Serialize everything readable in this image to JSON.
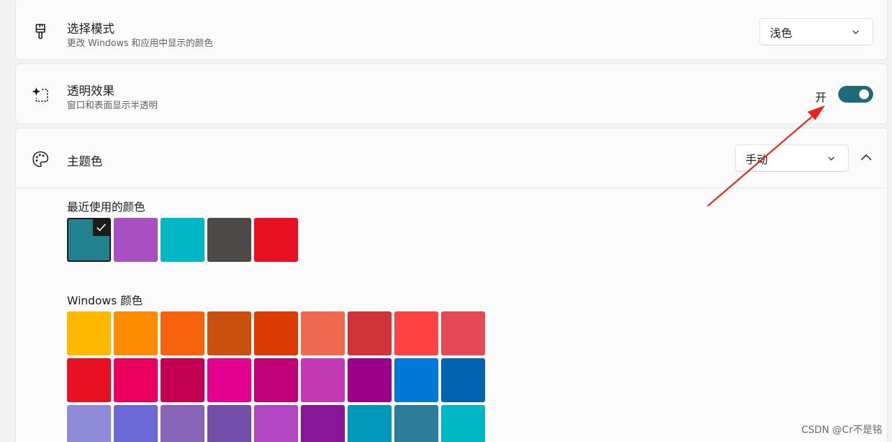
{
  "mode": {
    "title": "选择模式",
    "subtitle": "更改 Windows 和应用中显示的颜色",
    "dropdown_value": "浅色"
  },
  "transparency": {
    "title": "透明效果",
    "subtitle": "窗口和表面显示半透明",
    "toggle_label": "开",
    "toggle_on": true
  },
  "accent": {
    "title": "主题色",
    "dropdown_value": "手动",
    "recent_title": "最近使用的颜色",
    "recent_colors": [
      "#23808f",
      "#a84fc1",
      "#00b7c3",
      "#4c4a48",
      "#e81123"
    ],
    "windows_title": "Windows 颜色",
    "windows_colors": [
      [
        "#ffb900",
        "#ff8c00",
        "#f7630c",
        "#ca5010",
        "#da3b01",
        "#ef6950",
        "#d13438",
        "#ff4343",
        "#e74856"
      ],
      [
        "#e81123",
        "#ea005e",
        "#c30052",
        "#e3008c",
        "#bf0077",
        "#c239b3",
        "#9a0089",
        "#0078d7",
        "#0063b1"
      ],
      [
        "#8e8cd8",
        "#6b69d6",
        "#8764b8",
        "#744da9",
        "#b146c2",
        "#881798",
        "#0099bc",
        "#2d7d9a",
        "#00b7c3"
      ]
    ]
  },
  "colors": {
    "toggle_accent": "#1f6a7a",
    "annotation_arrow": "#e8231f"
  },
  "watermark": "CSDN @Cr不是铭"
}
